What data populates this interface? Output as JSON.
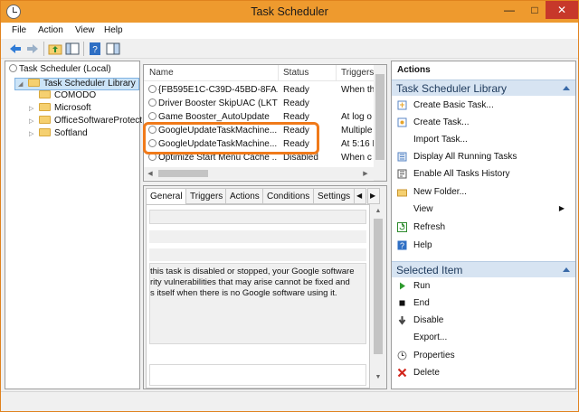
{
  "window": {
    "title": "Task Scheduler"
  },
  "controls": {
    "minimize": "—",
    "maximize": "□",
    "close": "✕"
  },
  "menu": [
    "File",
    "Action",
    "View",
    "Help"
  ],
  "tree": {
    "root": "Task Scheduler (Local)",
    "library": "Task Scheduler Library",
    "children": [
      {
        "label": "COMODO",
        "expandable": false
      },
      {
        "label": "Microsoft",
        "expandable": true
      },
      {
        "label": "OfficeSoftwareProtect",
        "expandable": true
      },
      {
        "label": "Softland",
        "expandable": true
      }
    ]
  },
  "tasklist": {
    "columns": [
      "Name",
      "Status",
      "Triggers"
    ],
    "rows": [
      {
        "name": "{FB595E1C-C39D-45BD-8FA...",
        "status": "Ready",
        "trigger": "When th"
      },
      {
        "name": "Driver Booster SkipUAC (LKTT)",
        "status": "Ready",
        "trigger": ""
      },
      {
        "name": "Game Booster_AutoUpdate",
        "status": "Ready",
        "trigger": "At log o"
      },
      {
        "name": "GoogleUpdateTaskMachine...",
        "status": "Ready",
        "trigger": "Multiple"
      },
      {
        "name": "GoogleUpdateTaskMachine...",
        "status": "Ready",
        "trigger": "At 5:16 F"
      },
      {
        "name": "Optimize Start Menu Cache ...",
        "status": "Disabled",
        "trigger": "When c"
      }
    ]
  },
  "detail": {
    "tabs": [
      "General",
      "Triggers",
      "Actions",
      "Conditions",
      "Settings"
    ],
    "description_lines": [
      "this task is disabled or stopped, your Google software",
      "rity vulnerabilities that may arise cannot be fixed and",
      "s itself when there is no Google software using it."
    ]
  },
  "actions": {
    "header": "Actions",
    "library_section": "Task Scheduler Library",
    "library_items": [
      "Create Basic Task...",
      "Create Task...",
      "Import Task...",
      "Display All Running Tasks",
      "Enable All Tasks History",
      "New Folder...",
      "View",
      "Refresh",
      "Help"
    ],
    "selected_section": "Selected Item",
    "selected_items": [
      "Run",
      "End",
      "Disable",
      "Export...",
      "Properties",
      "Delete"
    ]
  }
}
